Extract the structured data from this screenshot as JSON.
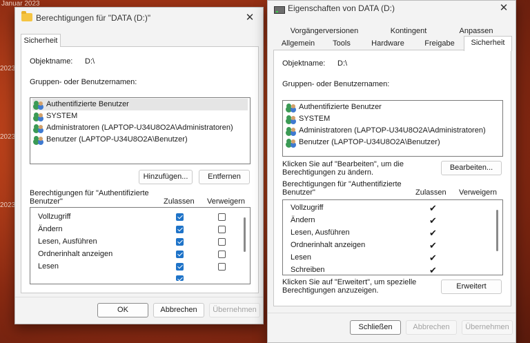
{
  "desktop": {
    "fragments": [
      "Januar 2023",
      "2023",
      "2023",
      "2023"
    ]
  },
  "left_dialog": {
    "title": "Berechtigungen für \"DATA (D:)\"",
    "close": "✕",
    "tab": "Sicherheit",
    "object_label": "Objektname:",
    "object_value": "D:\\",
    "group_label": "Gruppen- oder Benutzernamen:",
    "users": [
      "Authentifizierte Benutzer",
      "SYSTEM",
      "Administratoren (LAPTOP-U34U8O2A\\Administratoren)",
      "Benutzer (LAPTOP-U34U8O2A\\Benutzer)"
    ],
    "add_button": "Hinzufügen...",
    "remove_button": "Entfernen",
    "perm_label": "Berechtigungen für \"Authentifizierte Benutzer\"",
    "allow_header": "Zulassen",
    "deny_header": "Verweigern",
    "permissions": [
      {
        "name": "Vollzugriff",
        "allow": true,
        "deny": false
      },
      {
        "name": "Ändern",
        "allow": true,
        "deny": false
      },
      {
        "name": "Lesen, Ausführen",
        "allow": true,
        "deny": false
      },
      {
        "name": "Ordnerinhalt anzeigen",
        "allow": true,
        "deny": false
      },
      {
        "name": "Lesen",
        "allow": true,
        "deny": false
      }
    ],
    "ok_button": "OK",
    "cancel_button": "Abbrechen",
    "apply_button": "Übernehmen"
  },
  "right_dialog": {
    "title": "Eigenschaften von DATA (D:)",
    "close": "✕",
    "tabs_row1": [
      "Vorgängerversionen",
      "Kontingent",
      "Anpassen"
    ],
    "tabs_row2": [
      "Allgemein",
      "Tools",
      "Hardware",
      "Freigabe",
      "Sicherheit"
    ],
    "object_label": "Objektname:",
    "object_value": "D:\\",
    "group_label": "Gruppen- oder Benutzernamen:",
    "users": [
      "Authentifizierte Benutzer",
      "SYSTEM",
      "Administratoren (LAPTOP-U34U8O2A\\Administratoren)",
      "Benutzer (LAPTOP-U34U8O2A\\Benutzer)"
    ],
    "edit_hint": "Klicken Sie auf \"Bearbeiten\", um die Berechtigungen zu ändern.",
    "edit_button": "Bearbeiten...",
    "perm_label": "Berechtigungen für \"Authentifizierte Benutzer\"",
    "allow_header": "Zulassen",
    "deny_header": "Verweigern",
    "permissions": [
      {
        "name": "Vollzugriff",
        "allow": true
      },
      {
        "name": "Ändern",
        "allow": true
      },
      {
        "name": "Lesen, Ausführen",
        "allow": true
      },
      {
        "name": "Ordnerinhalt anzeigen",
        "allow": true
      },
      {
        "name": "Lesen",
        "allow": true
      },
      {
        "name": "Schreiben",
        "allow": true
      }
    ],
    "advanced_hint": "Klicken Sie auf \"Erweitert\", um spezielle Berechtigungen anzuzeigen.",
    "advanced_button": "Erweitert",
    "close_button": "Schließen",
    "cancel_button": "Abbrechen",
    "apply_button": "Übernehmen"
  }
}
